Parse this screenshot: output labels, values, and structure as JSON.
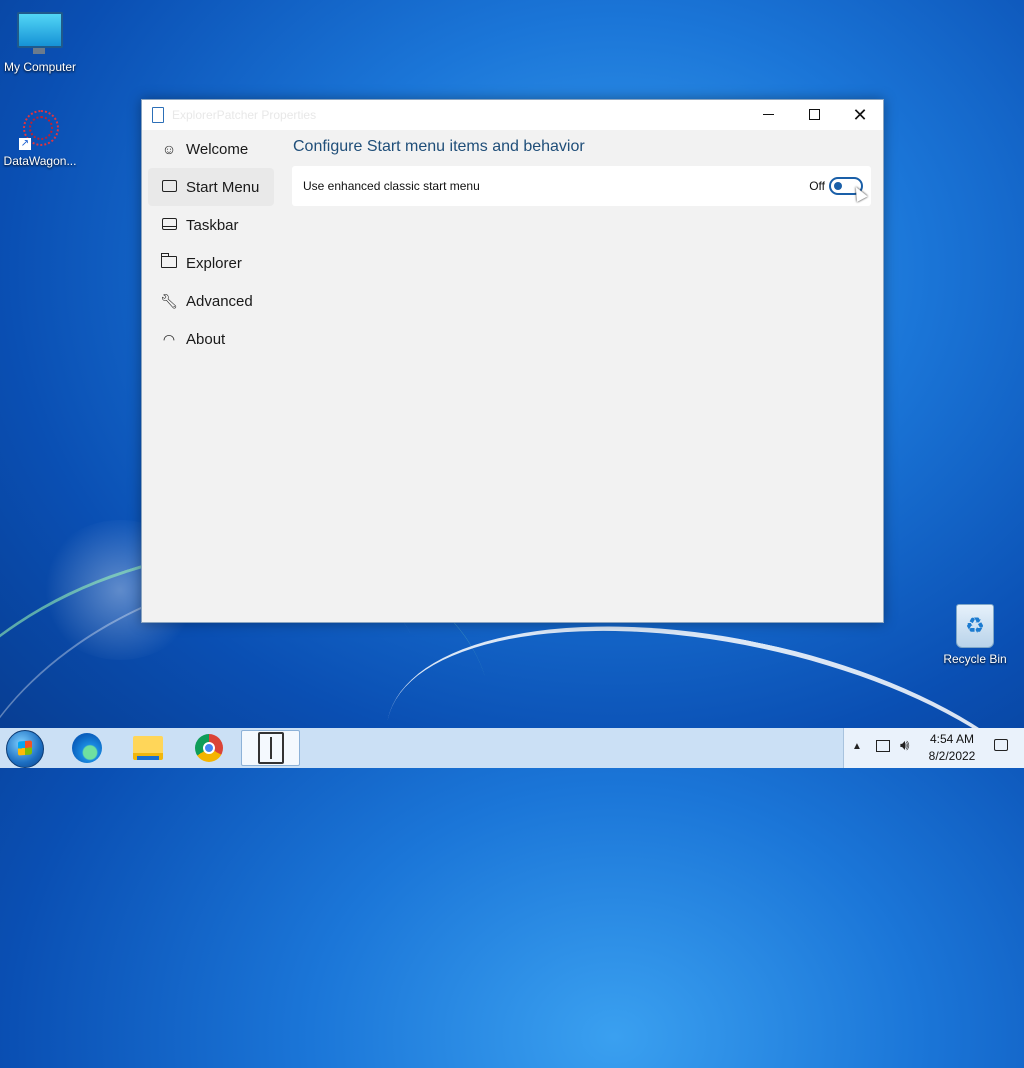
{
  "desktop": {
    "icons": [
      {
        "label": "My Computer"
      },
      {
        "label": "DataWagon..."
      },
      {
        "label": "Recycle Bin"
      }
    ]
  },
  "window": {
    "title": "ExplorerPatcher Properties",
    "controls": {
      "minimize": "minimize",
      "maximize": "maximize",
      "close": "✕"
    },
    "sidebar": {
      "items": [
        {
          "label": "Welcome",
          "icon": "smiley-icon"
        },
        {
          "label": "Start Menu",
          "icon": "start-menu-icon",
          "active": true
        },
        {
          "label": "Taskbar",
          "icon": "taskbar-icon"
        },
        {
          "label": "Explorer",
          "icon": "folder-icon"
        },
        {
          "label": "Advanced",
          "icon": "wrench-icon"
        },
        {
          "label": "About",
          "icon": "gauge-icon"
        }
      ]
    },
    "main": {
      "heading": "Configure Start menu items and behavior",
      "settings": [
        {
          "label": "Use enhanced classic start menu",
          "state": "Off"
        }
      ]
    }
  },
  "taskbar": {
    "apps": [
      "start-button",
      "edge",
      "file-explorer",
      "chrome",
      "explorerpatcher"
    ],
    "clock": {
      "time": "4:54 AM",
      "date": "8/2/2022"
    }
  },
  "colors": {
    "accent": "#1a5fa8",
    "heading": "#1f4e79"
  }
}
